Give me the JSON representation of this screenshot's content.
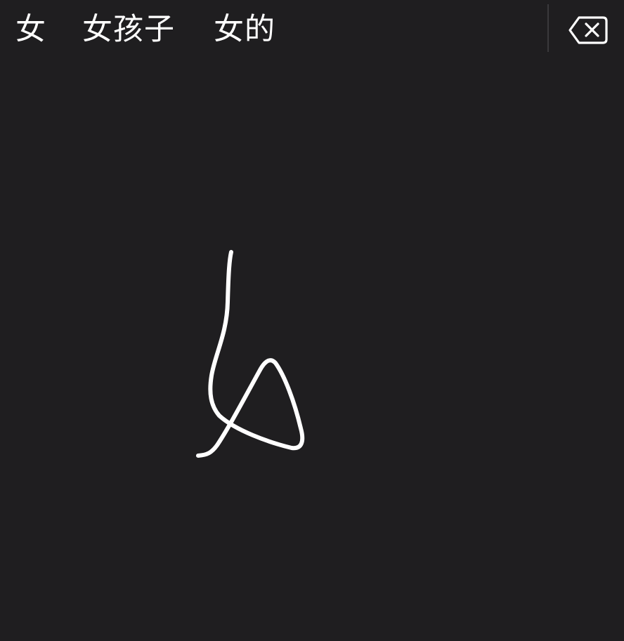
{
  "candidates": [
    {
      "text": "女"
    },
    {
      "text": "女孩子"
    },
    {
      "text": "女的"
    }
  ],
  "icons": {
    "backspace": "backspace-icon"
  },
  "colors": {
    "background": "#1f1e20",
    "text": "#ffffff",
    "ink": "#ffffff",
    "divider": "#3a393c"
  }
}
